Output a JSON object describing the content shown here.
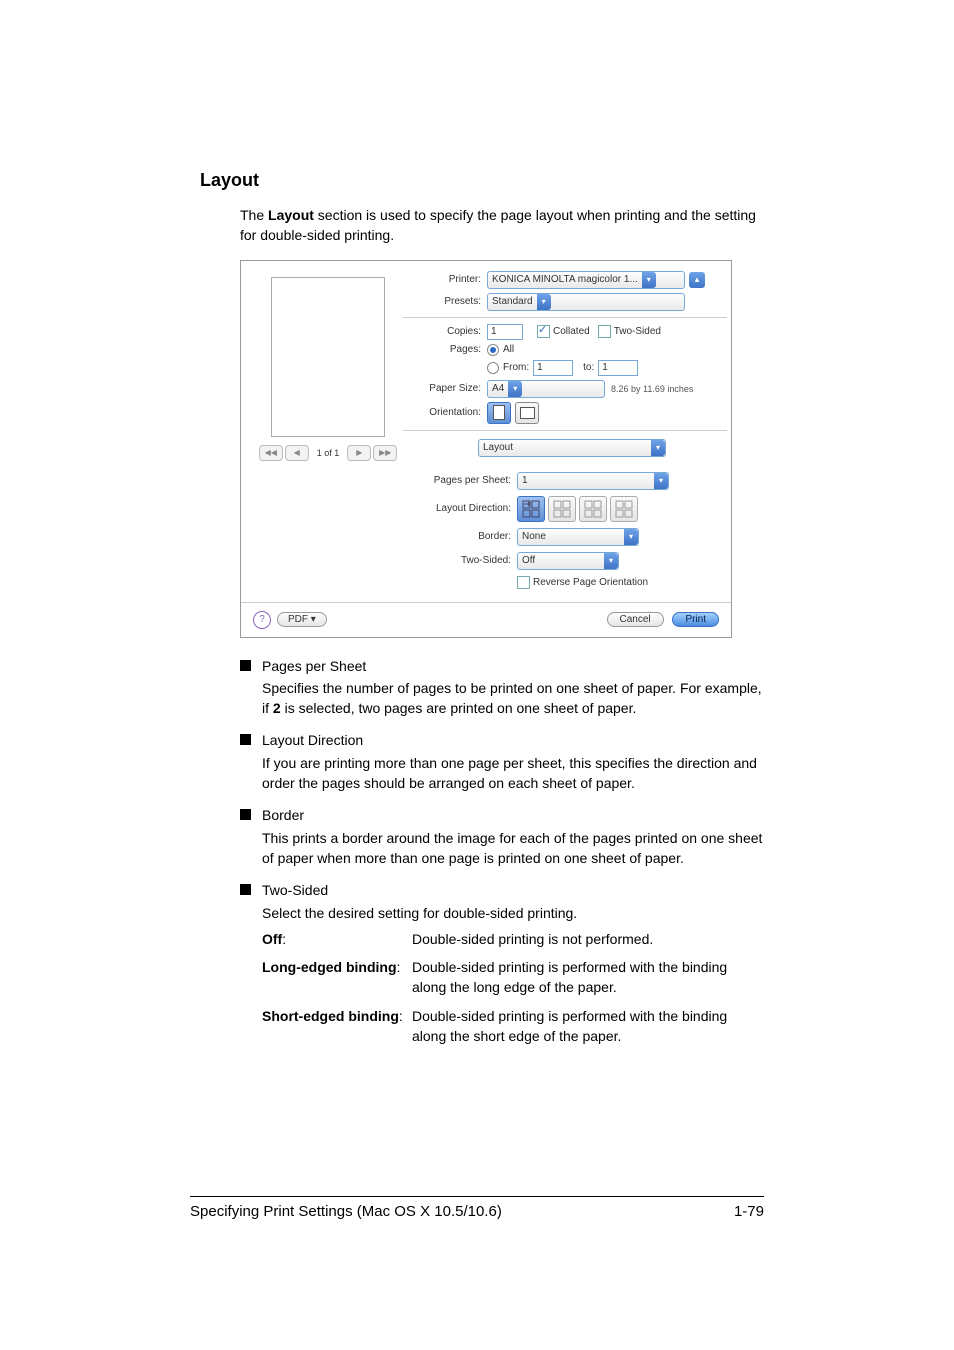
{
  "title": "Layout",
  "intro_before": "The ",
  "intro_bold": "Layout",
  "intro_after": " section is used to specify the page layout when printing and the setting for double-sided printing.",
  "dialog": {
    "printer_label": "Printer:",
    "printer_value": "KONICA MINOLTA magicolor 1...",
    "presets_label": "Presets:",
    "presets_value": "Standard",
    "copies_label": "Copies:",
    "copies_value": "1",
    "collated_label": "Collated",
    "two_sided_chk_label": "Two-Sided",
    "pages_label": "Pages:",
    "pages_all": "All",
    "pages_from": "From:",
    "pages_from_val": "1",
    "pages_to": "to:",
    "pages_to_val": "1",
    "paper_size_label": "Paper Size:",
    "paper_size_value": "A4",
    "paper_size_dim": "8.26 by 11.69 inches",
    "orientation_label": "Orientation:",
    "panel_value": "Layout",
    "pps_label": "Pages per Sheet:",
    "pps_value": "1",
    "dir_label": "Layout Direction:",
    "border_label": "Border:",
    "border_value": "None",
    "twos_label": "Two-Sided:",
    "twos_value": "Off",
    "reverse_label": "Reverse Page Orientation",
    "pager_text": "1 of 1",
    "pdf_btn": "PDF ▾",
    "cancel_btn": "Cancel",
    "print_btn": "Print"
  },
  "bullets": {
    "pps_head": "Pages per Sheet",
    "pps_body_a": "Specifies the number of pages to be printed on one sheet of paper. For example, if ",
    "pps_body_bold": "2",
    "pps_body_b": " is selected, two pages are printed on one sheet of paper.",
    "dir_head": "Layout Direction",
    "dir_body": "If you are printing more than one page per sheet, this specifies the direction and order the pages should be arranged on each sheet of paper.",
    "border_head": "Border",
    "border_body": "This prints a border around the image for each of the pages printed on one sheet of paper when more than one page is printed on one sheet of paper.",
    "twos_head": "Two-Sided",
    "twos_body": "Select the desired setting for double-sided printing.",
    "off_term": "Off",
    "off_def": "Double-sided printing is not performed.",
    "long_term": "Long-edged binding",
    "long_def": "Double-sided printing is performed with the binding along the long edge of the paper.",
    "short_term": "Short-edged binding",
    "short_def": "Double-sided printing is performed with the binding along the short edge of the paper."
  },
  "footer_left": "Specifying Print Settings (Mac OS X 10.5/10.6)",
  "footer_right": "1-79"
}
